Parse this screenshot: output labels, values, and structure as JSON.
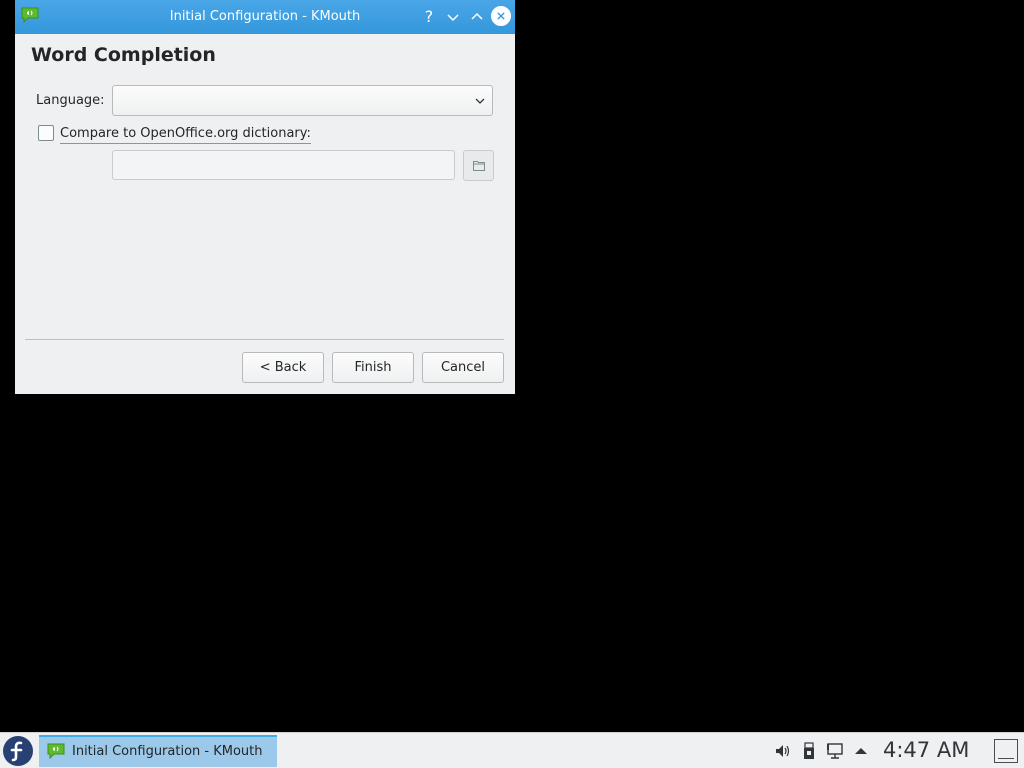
{
  "window": {
    "title": "Initial Configuration - KMouth",
    "help_glyph": "?"
  },
  "page": {
    "title": "Word Completion",
    "language_label": "Language:",
    "language_value": "",
    "compare_label": "Compare to OpenOffice.org dictionary:",
    "compare_checked": false,
    "dictionary_path": ""
  },
  "buttons": {
    "back": "< Back",
    "finish": "Finish",
    "cancel": "Cancel"
  },
  "taskbar": {
    "task_label": "Initial Configuration - KMouth",
    "clock": "4:47 AM"
  },
  "colors": {
    "titlebar": "#3498db",
    "window_bg": "#eff0f1",
    "task_active": "#9cc9ea",
    "accent": "#3daee9",
    "app_icon": "#5dbb2f"
  },
  "icons": {
    "app": "kmouth-speech-bubble-icon",
    "launcher": "fedora-logo-icon",
    "tray": [
      "speaker-icon",
      "usb-device-icon",
      "network-icon",
      "expand-tray-arrow-icon"
    ]
  }
}
